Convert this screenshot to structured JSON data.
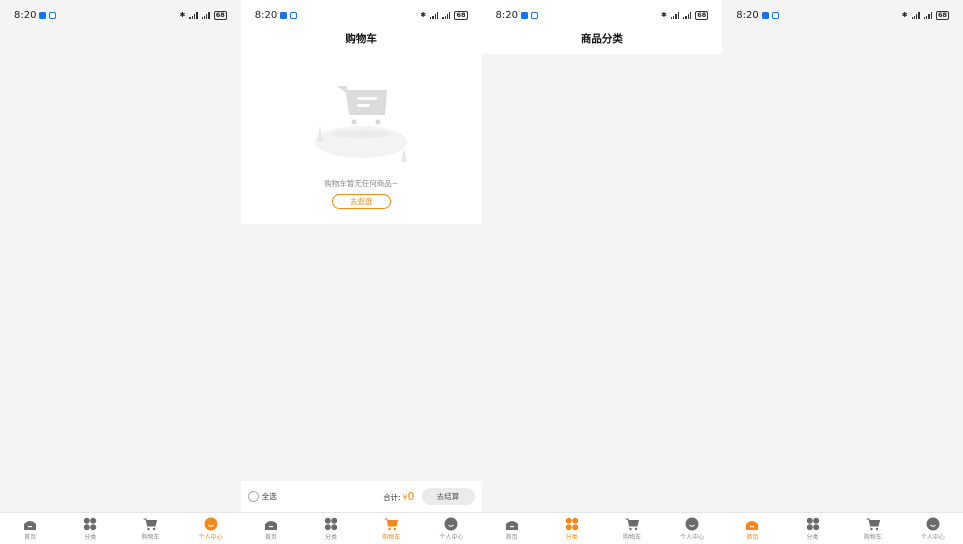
{
  "status_bar": {
    "time": "8:20",
    "battery": "68"
  },
  "colors": {
    "accent": "#f08a1c",
    "icon_inactive": "#6b6b6b",
    "status_icon": "#1a73e8"
  },
  "tabs": [
    "首页",
    "分类",
    "购物车",
    "个人中心"
  ],
  "screens": [
    {
      "id": "profile",
      "title": "",
      "active_tab": 3
    },
    {
      "id": "cart",
      "title": "购物车",
      "active_tab": 2,
      "empty_text": "购物车暂无任何商品~",
      "go_shopping": "去逛逛",
      "select_all": "全选",
      "total_label": "合计:",
      "currency": "¥",
      "total_value": "0",
      "checkout": "去结算"
    },
    {
      "id": "category",
      "title": "商品分类",
      "active_tab": 1
    },
    {
      "id": "home",
      "title": "",
      "active_tab": 0
    }
  ],
  "icons": {
    "home": "home-icon",
    "category": "category-grid-icon",
    "cart": "cart-icon",
    "profile": "profile-icon",
    "bluetooth": "bluetooth-icon",
    "signal": "signal-icon",
    "battery": "battery-icon"
  }
}
